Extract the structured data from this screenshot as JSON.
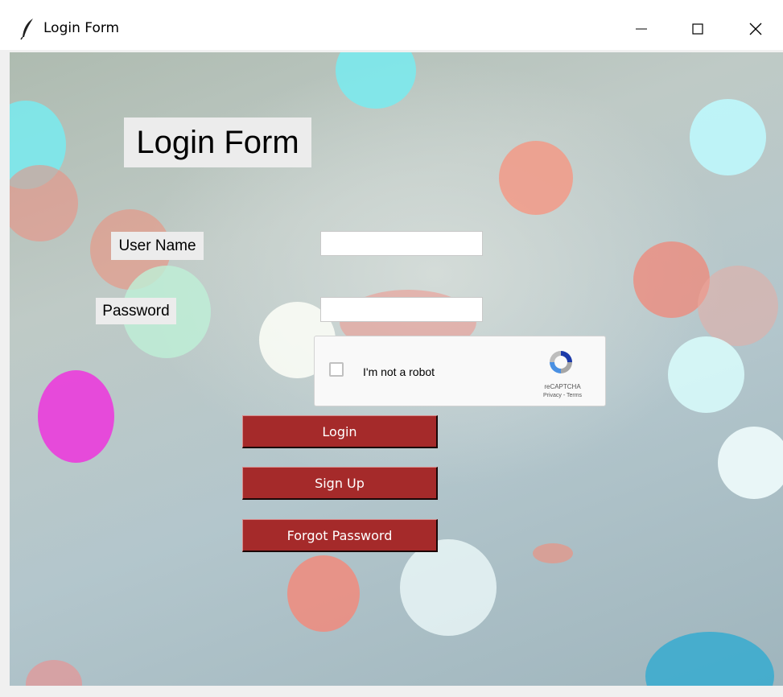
{
  "window": {
    "title": "Login Form",
    "icon": "feather-icon",
    "controls": [
      "minimize-icon",
      "maximize-icon",
      "close-icon"
    ]
  },
  "form": {
    "heading": "Login Form",
    "username_label": "User Name",
    "username_value": "",
    "password_label": "Password",
    "password_value": ""
  },
  "captcha": {
    "label": "I'm not a robot",
    "checked": false,
    "brand": "reCAPTCHA",
    "links": "Privacy - Terms"
  },
  "buttons": {
    "login": "Login",
    "signup": "Sign Up",
    "forgot": "Forgot Password"
  },
  "colors": {
    "button_bg": "#a52a2a",
    "button_text": "#ffffff",
    "label_bg": "#ececec"
  }
}
